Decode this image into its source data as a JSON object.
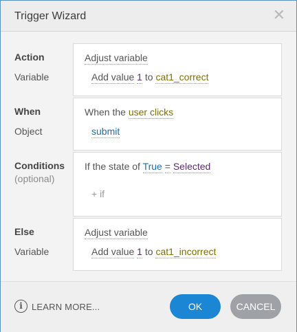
{
  "dialog": {
    "title": "Trigger Wizard",
    "close_icon": "close-icon"
  },
  "action": {
    "label": "Action",
    "sub_label": "Variable",
    "value": "Adjust variable",
    "detail": {
      "op": "Add value",
      "amount": "1",
      "to": "to",
      "variable": "cat1_correct"
    }
  },
  "when": {
    "label": "When",
    "sub_label": "Object",
    "prefix": "When the",
    "event": "user clicks",
    "object": "submit"
  },
  "conditions": {
    "label": "Conditions",
    "sub_label": "(optional)",
    "prefix": "If the state of",
    "subject": "True",
    "operator": "=",
    "state": "Selected",
    "add_if": "+ if"
  },
  "else": {
    "label": "Else",
    "sub_label": "Variable",
    "value": "Adjust variable",
    "detail": {
      "op": "Add value",
      "amount": "1",
      "to": "to",
      "variable": "cat1_incorrect"
    }
  },
  "footer": {
    "info_icon": "info-icon",
    "learn_more": "LEARN MORE...",
    "ok_label": "OK",
    "cancel_label": "CANCEL"
  },
  "colors": {
    "accent": "#1a86d4",
    "cancel": "#9ea2a6",
    "link_blue": "#1f6ea8",
    "variable_olive": "#7f6f00",
    "state_purple": "#5a2a6e"
  }
}
